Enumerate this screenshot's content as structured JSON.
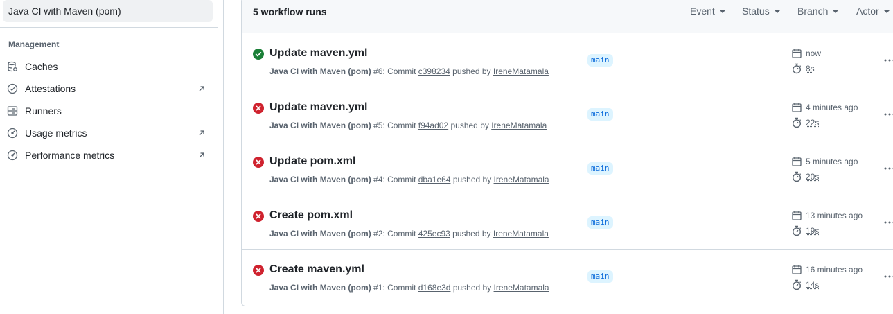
{
  "sidebar": {
    "selected_workflow": "Java CI with Maven (pom)",
    "section_heading": "Management",
    "items": [
      {
        "label": "Caches",
        "icon": "database-icon",
        "external": false
      },
      {
        "label": "Attestations",
        "icon": "verified-icon",
        "external": true
      },
      {
        "label": "Runners",
        "icon": "server-icon",
        "external": false
      },
      {
        "label": "Usage metrics",
        "icon": "meter-icon",
        "external": true
      },
      {
        "label": "Performance metrics",
        "icon": "meter-icon",
        "external": true
      }
    ]
  },
  "runs": {
    "count_label": "5 workflow runs",
    "filters": [
      "Event",
      "Status",
      "Branch",
      "Actor"
    ],
    "items": [
      {
        "status": "success",
        "title": "Update maven.yml",
        "workflow": "Java CI with Maven (pom)",
        "number": "#6",
        "commit_prefix": ": Commit",
        "commit": "c398234",
        "pushed_by": "pushed by",
        "actor": "IreneMatamala",
        "branch": "main",
        "when": "now",
        "duration": "8s"
      },
      {
        "status": "failure",
        "title": "Update maven.yml",
        "workflow": "Java CI with Maven (pom)",
        "number": "#5",
        "commit_prefix": ": Commit",
        "commit": "f94ad02",
        "pushed_by": "pushed by",
        "actor": "IreneMatamala",
        "branch": "main",
        "when": "4 minutes ago",
        "duration": "22s"
      },
      {
        "status": "failure",
        "title": "Update pom.xml",
        "workflow": "Java CI with Maven (pom)",
        "number": "#4",
        "commit_prefix": ": Commit",
        "commit": "dba1e64",
        "pushed_by": "pushed by",
        "actor": "IreneMatamala",
        "branch": "main",
        "when": "5 minutes ago",
        "duration": "20s"
      },
      {
        "status": "failure",
        "title": "Create pom.xml",
        "workflow": "Java CI with Maven (pom)",
        "number": "#2",
        "commit_prefix": ": Commit",
        "commit": "425ec93",
        "pushed_by": "pushed by",
        "actor": "IreneMatamala",
        "branch": "main",
        "when": "13 minutes ago",
        "duration": "19s"
      },
      {
        "status": "failure",
        "title": "Create maven.yml",
        "workflow": "Java CI with Maven (pom)",
        "number": "#1",
        "commit_prefix": ": Commit",
        "commit": "d168e3d",
        "pushed_by": "pushed by",
        "actor": "IreneMatamala",
        "branch": "main",
        "when": "16 minutes ago",
        "duration": "14s"
      }
    ]
  },
  "colors": {
    "success": "#1a7f37",
    "failure": "#cf222e",
    "branch_bg": "#ddf4ff",
    "branch_fg": "#0969da"
  }
}
